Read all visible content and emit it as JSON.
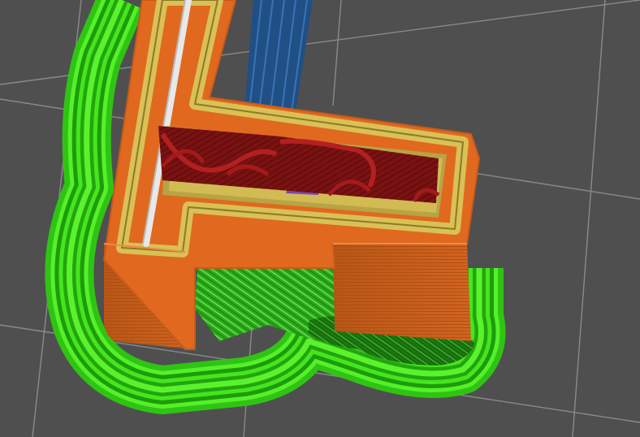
{
  "viewport": {
    "kind": "3d-print-gcode-preview",
    "background_color": "#4f4f50",
    "grid_color": "#8a8a8c"
  },
  "feature_colors": {
    "skirt_brim": "#3ee01a",
    "skirt_brim_dark": "#1f8f0c",
    "support": "#24a515",
    "external_perimeter": "#e0691f",
    "perimeter": "#d9c155",
    "overhang_perimeter": "#9a1a1a",
    "solid_infill": "#7b46b8",
    "internal_infill": "#1f4f85",
    "wipe_travel": "#e6e6e6"
  }
}
